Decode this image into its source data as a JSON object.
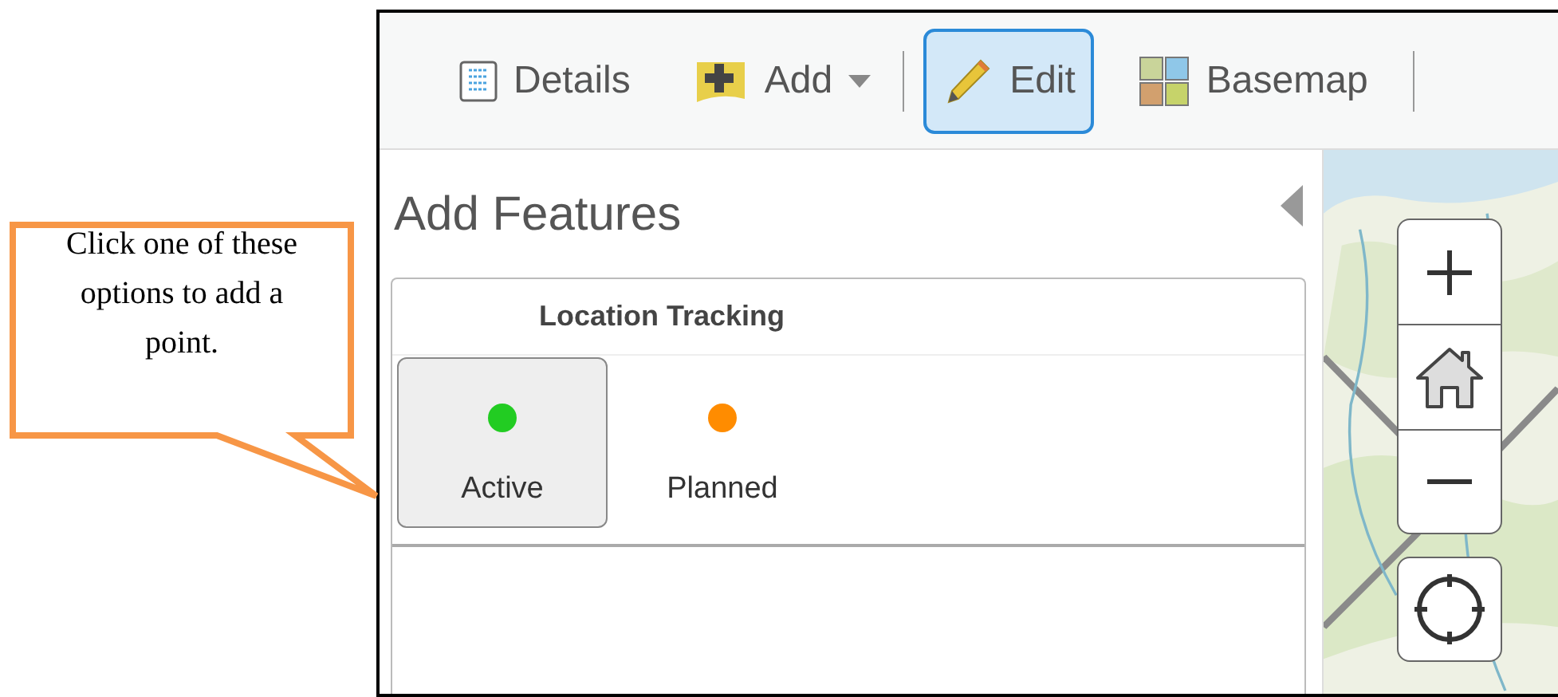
{
  "callout": {
    "text": "Click one of these options to add a point."
  },
  "toolbar": [
    {
      "label": "Details",
      "kind": "details",
      "selected": false
    },
    {
      "label": "Add",
      "kind": "add",
      "selected": false
    },
    {
      "label": "Edit",
      "kind": "edit",
      "selected": true
    },
    {
      "label": "Basemap",
      "kind": "basemap",
      "selected": false
    }
  ],
  "panel": {
    "title": "Add Features",
    "group": {
      "title": "Location Tracking",
      "templates": [
        {
          "label": "Active",
          "color": "#22cc22",
          "selected": true
        },
        {
          "label": "Planned",
          "color": "#ff8c00",
          "selected": false
        }
      ]
    }
  },
  "map": {
    "controls": [
      {
        "kind": "zoom-in"
      },
      {
        "kind": "home"
      },
      {
        "kind": "zoom-out"
      },
      {
        "kind": "locate"
      }
    ]
  }
}
